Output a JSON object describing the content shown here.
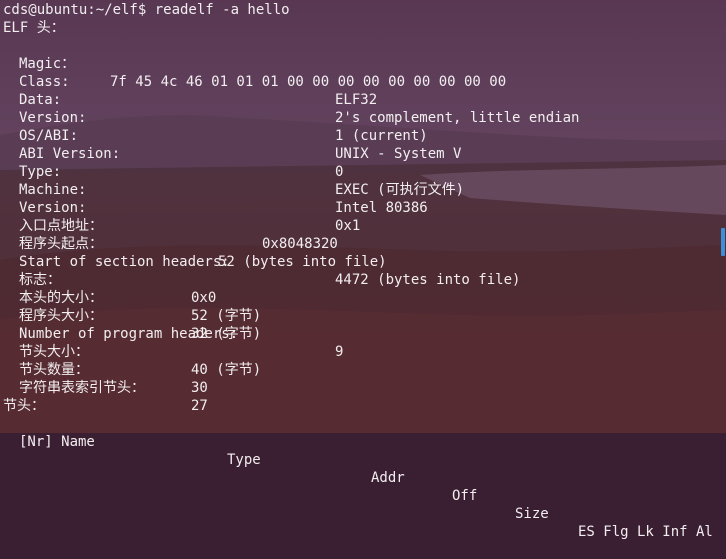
{
  "prompt": "cds@ubuntu:~/elf$ readelf -a hello",
  "elf_header_title": "ELF 头：",
  "fields": [
    {
      "label": "Magic：",
      "value": "7f 45 4c 46 01 01 01 00 00 00 00 00 00 00 00 00"
    },
    {
      "label": "Class:",
      "value": "ELF32"
    },
    {
      "label": "Data:",
      "value": "2's complement, little endian"
    },
    {
      "label": "Version:",
      "value": "1 (current)"
    },
    {
      "label": "OS/ABI:",
      "value": "UNIX - System V"
    },
    {
      "label": "ABI Version:",
      "value": "0"
    },
    {
      "label": "Type:",
      "value": "EXEC (可执行文件)"
    },
    {
      "label": "Machine:",
      "value": "Intel 80386"
    },
    {
      "label": "Version:",
      "value": "0x1"
    },
    {
      "label": "入口点地址：",
      "value": "0x8048320"
    },
    {
      "label": "程序头起点：",
      "value": "52 (bytes into file)"
    },
    {
      "label": "Start of section headers:",
      "value": "4472 (bytes into file)"
    },
    {
      "label": "标志：",
      "value": "0x0"
    },
    {
      "label": "本头的大小：",
      "value": "52 (字节)"
    },
    {
      "label": "程序头大小：",
      "value": "32 (字节)"
    },
    {
      "label": "Number of program headers:",
      "value": "9"
    },
    {
      "label": "节头大小：",
      "value": "40 (字节)"
    },
    {
      "label": "节头数量：",
      "value": "30"
    },
    {
      "label": "字符串表索引节头：",
      "value": "27"
    }
  ],
  "section_title": "节头：",
  "section_columns": [
    "[Nr] Name",
    "Type",
    "Addr",
    "Off",
    "Size",
    "ES Flg Lk Inf Al"
  ]
}
